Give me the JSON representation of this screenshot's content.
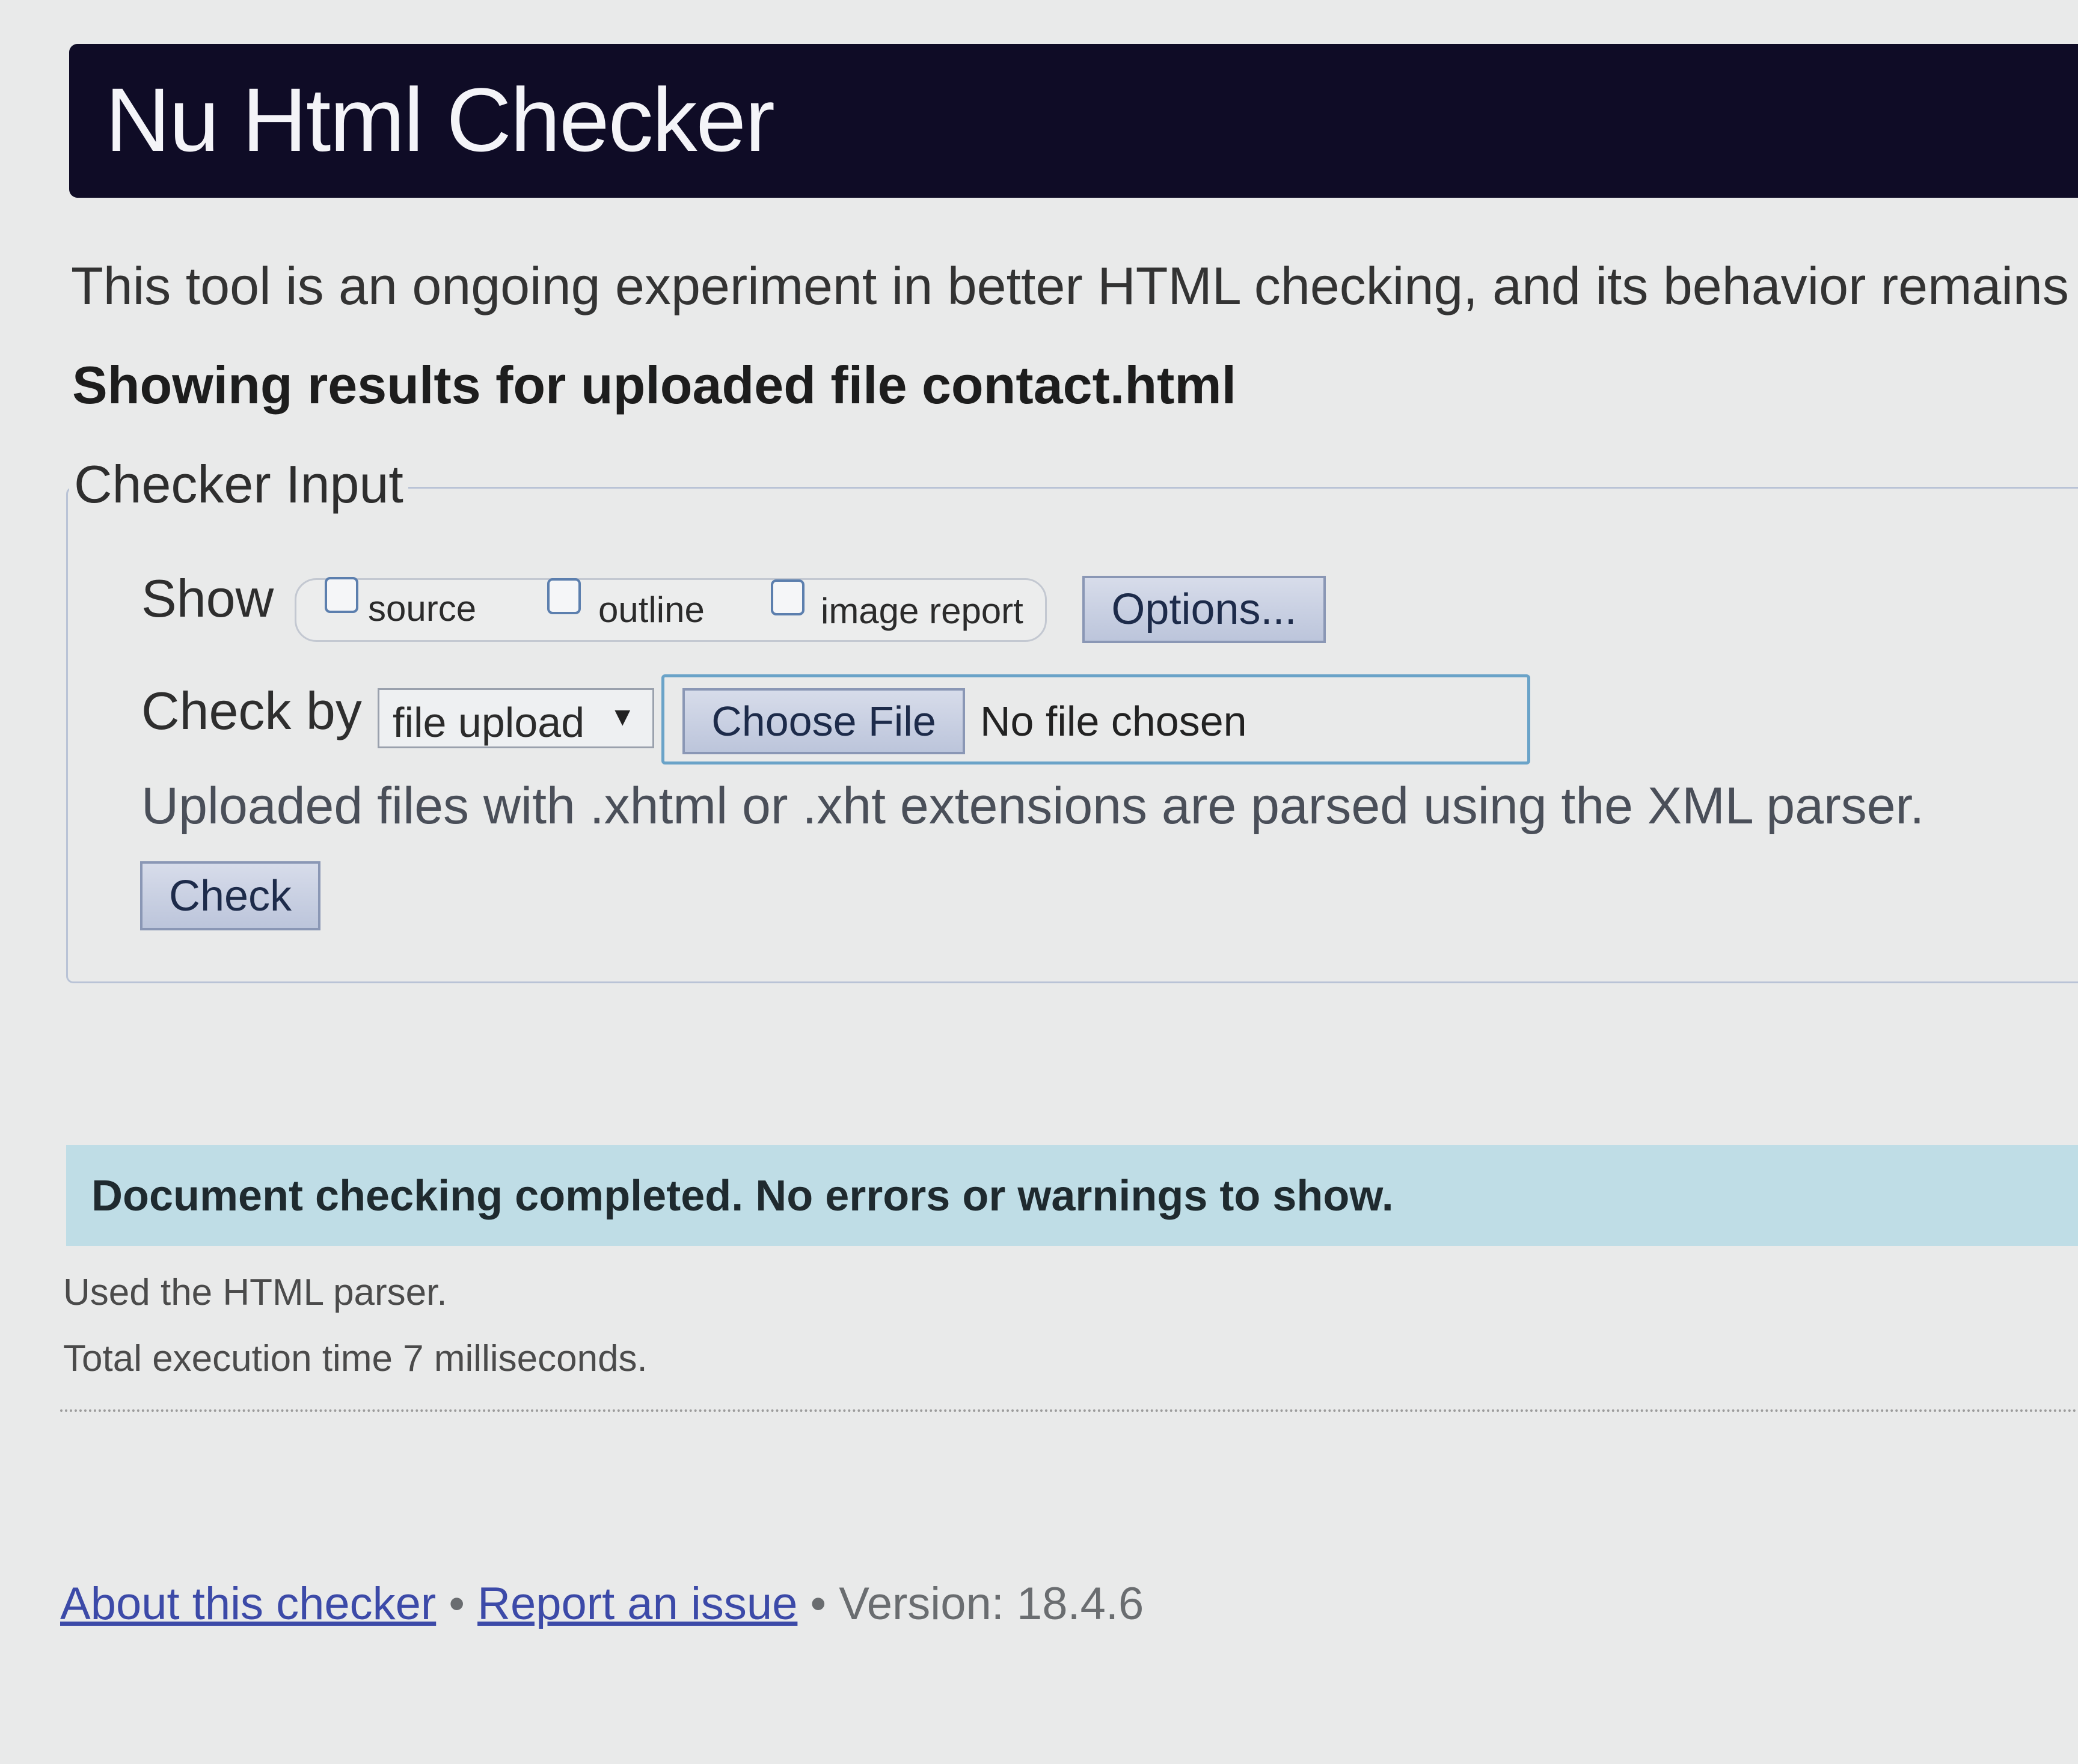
{
  "header": {
    "title": "Nu Html Checker"
  },
  "intro": {
    "text": "This tool is an ongoing experiment in better HTML checking, and its behavior remains"
  },
  "results": {
    "heading": "Showing results for uploaded file contact.html"
  },
  "checker_input": {
    "legend": "Checker Input",
    "show_label": "Show",
    "show_options": [
      {
        "label": "source",
        "checked": false
      },
      {
        "label": "outline",
        "checked": false
      },
      {
        "label": "image report",
        "checked": false
      }
    ],
    "options_button": "Options...",
    "check_by_label": "Check by",
    "check_by_value": "file upload",
    "choose_file_button": "Choose File",
    "file_status": "No file chosen",
    "parser_note": "Uploaded files with .xhtml or .xht extensions are parsed using the XML parser.",
    "check_button": "Check"
  },
  "status": {
    "message": "Document checking completed. No errors or warnings to show."
  },
  "meta": {
    "parser": "Used the HTML parser.",
    "execution_time": "Total execution time 7 milliseconds."
  },
  "footer": {
    "about_link": "About this checker",
    "report_link": "Report an issue",
    "separator": "•",
    "version": "Version: 18.4.6"
  },
  "colors": {
    "header_bg": "#0f0c26",
    "status_bg": "#bfdde6",
    "link": "#3c4aa8",
    "file_box_border": "#6aa3c8"
  }
}
